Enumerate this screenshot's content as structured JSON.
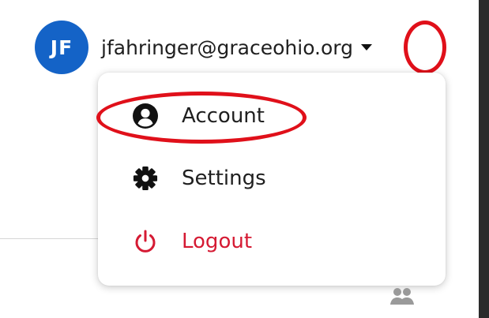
{
  "user": {
    "initials": "JF",
    "email": "jfahringer@graceohio.org",
    "avatar_color": "#1463c7"
  },
  "menu": {
    "items": [
      {
        "label": "Account",
        "icon": "account-circle-icon"
      },
      {
        "label": "Settings",
        "icon": "gear-icon"
      },
      {
        "label": "Logout",
        "icon": "power-icon",
        "color": "#d51a33"
      }
    ]
  },
  "annotations": {
    "highlight_color": "#e0101a",
    "highlighted": [
      "dropdown-toggle",
      "menu-item-account"
    ]
  },
  "background_icon": "people-icon"
}
